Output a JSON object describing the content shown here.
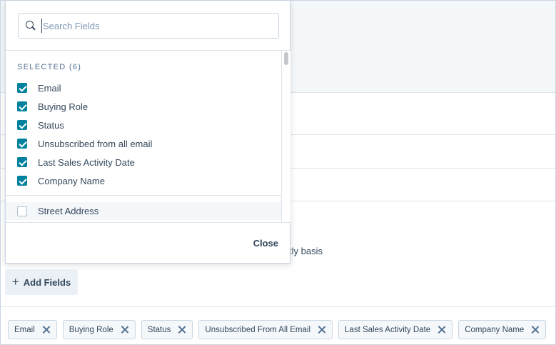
{
  "background": {
    "partial_text": "tly basis"
  },
  "add_fields": {
    "plus": "+",
    "label": "Add Fields"
  },
  "dropdown": {
    "search_placeholder": "Search Fields",
    "section_label": "SELECTED (6)",
    "selected_items": [
      {
        "label": "Email",
        "checked": true
      },
      {
        "label": "Buying Role",
        "checked": true
      },
      {
        "label": "Status",
        "checked": true
      },
      {
        "label": "Unsubscribed from all email",
        "checked": true
      },
      {
        "label": "Last Sales Activity Date",
        "checked": true
      },
      {
        "label": "Company Name",
        "checked": true
      }
    ],
    "other_items": [
      {
        "label": "Street Address",
        "checked": false
      }
    ],
    "close_label": "Close"
  },
  "chips": [
    {
      "label": "Email"
    },
    {
      "label": "Buying Role"
    },
    {
      "label": "Status"
    },
    {
      "label": "Unsubscribed From All Email"
    },
    {
      "label": "Last Sales Activity Date"
    },
    {
      "label": "Company Name"
    }
  ],
  "colors": {
    "checkbox_accent": "#00819e",
    "text": "#33475b",
    "border": "#cbd6e2"
  }
}
